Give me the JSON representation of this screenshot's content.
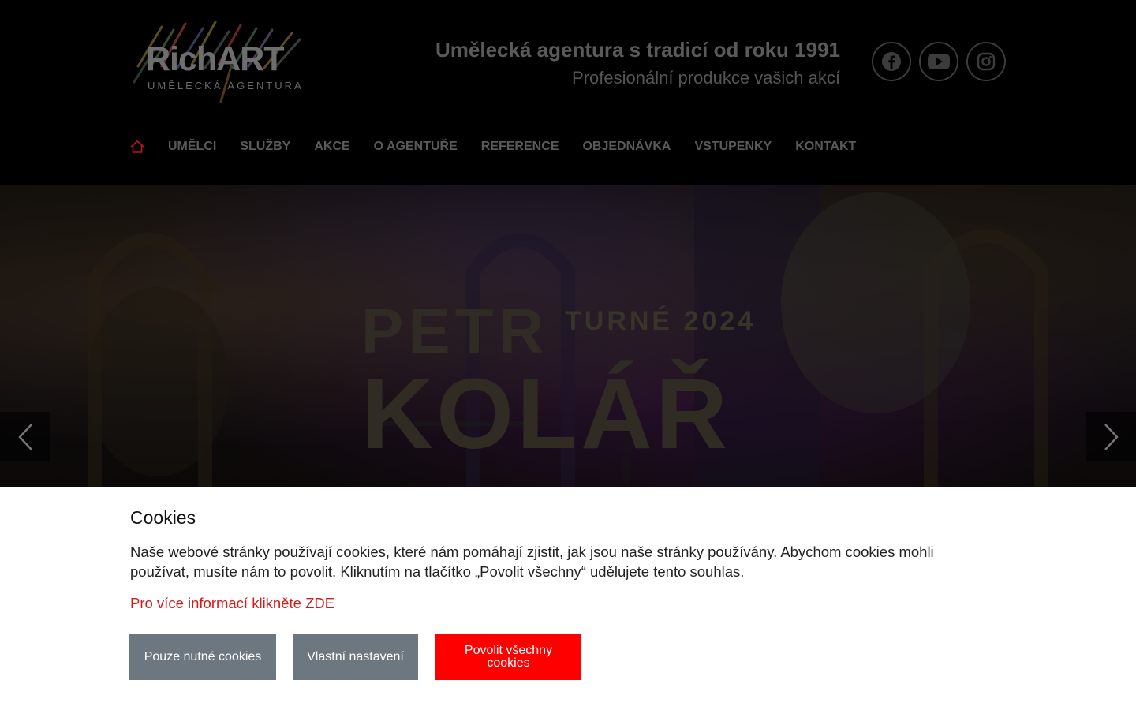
{
  "header": {
    "logo": {
      "word": "RichART",
      "subtitle": "UMĚLECKÁ AGENTURA"
    },
    "tagline": {
      "main": "Umělecká agentura s tradicí od roku 1991",
      "sub": "Profesionální produkce vašich akcí"
    },
    "social": [
      {
        "icon": "facebook-icon"
      },
      {
        "icon": "youtube-icon"
      },
      {
        "icon": "instagram-icon"
      }
    ]
  },
  "nav": {
    "home_icon": "home-icon",
    "home_color": "#c0141e",
    "items": [
      {
        "label": "UMĚLCI"
      },
      {
        "label": "SLUŽBY"
      },
      {
        "label": "AKCE"
      },
      {
        "label": "O AGENTUŘE"
      },
      {
        "label": "REFERENCE"
      },
      {
        "label": "OBJEDNÁVKA"
      },
      {
        "label": "VSTUPENKY"
      },
      {
        "label": "KONTAKT"
      }
    ]
  },
  "hero": {
    "line1": "PETR",
    "line1_badge": "TURNÉ 2024",
    "line2": "KOLÁŘ",
    "prev_icon": "chevron-left-icon",
    "next_icon": "chevron-right-icon"
  },
  "cookies": {
    "title": "Cookies",
    "text": "Naše webové stránky používají cookies, které nám pomáhají zjistit, jak jsou naše stránky používány. Abychom cookies mohli používat, musíte nám to povolit. Kliknutím na tlačítko „Povolit všechny“ udělujete tento souhlas.",
    "more_link": "Pro více informací klikněte ZDE",
    "buttons": {
      "necessary": "Pouze nutné cookies",
      "custom": "Vlastní nastavení",
      "accept_all": "Povolit všechny cookies"
    },
    "colors": {
      "link": "#d41a1a",
      "accept": "#ff0000",
      "secondary": "#6d7780"
    }
  }
}
